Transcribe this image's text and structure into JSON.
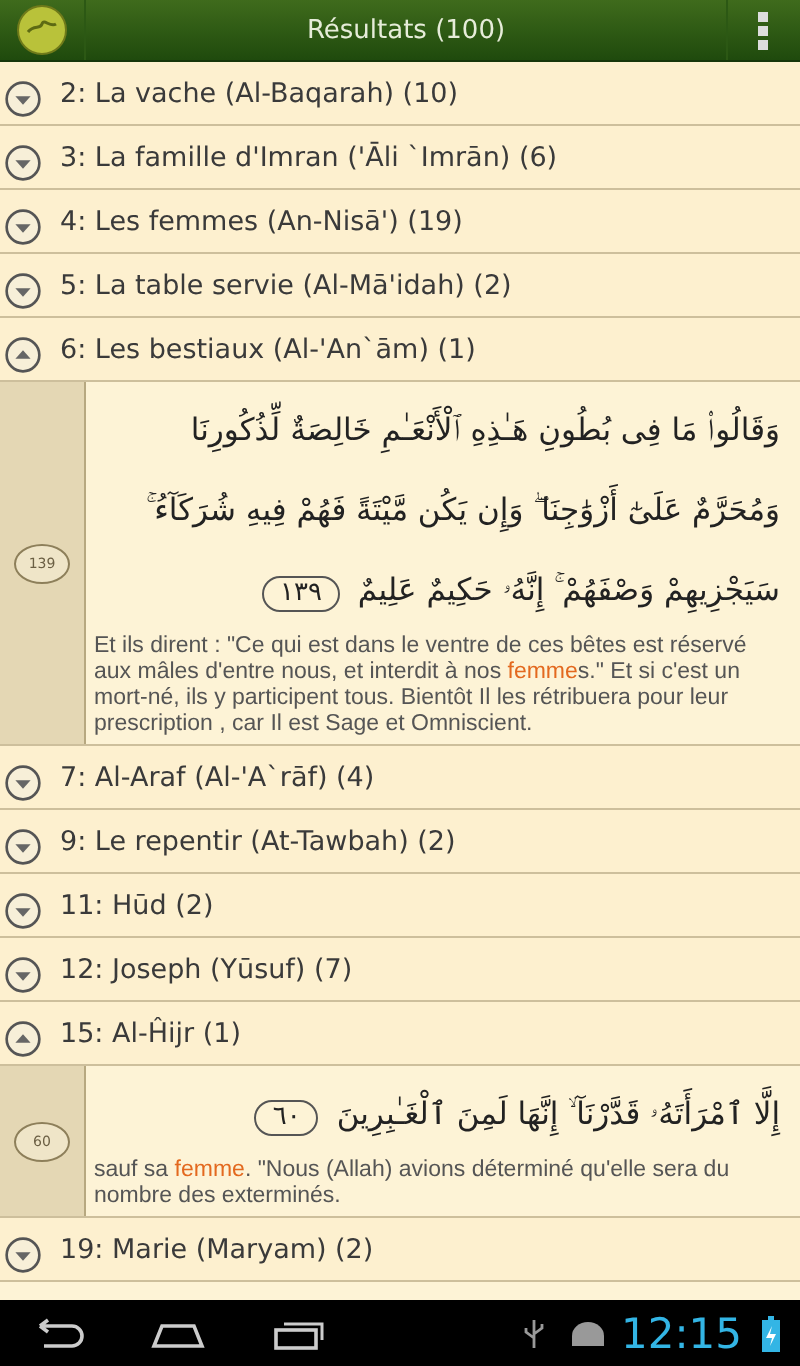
{
  "action_bar": {
    "title": "Résultats (100)"
  },
  "groups": [
    {
      "label": "2: La vache (Al-Baqarah) (10)",
      "expanded": false
    },
    {
      "label": "3: La famille d'Imran ('Āli `Imrān) (6)",
      "expanded": false
    },
    {
      "label": "4: Les femmes (An-Nisā') (19)",
      "expanded": false
    },
    {
      "label": "5: La table servie (Al-Mā'idah) (2)",
      "expanded": false
    },
    {
      "label": "6: Les bestiaux (Al-'An`ām) (1)",
      "expanded": true,
      "verses": [
        {
          "number": "139",
          "arabic": "وَقَالُوا۟ مَا فِى بُطُونِ هَـٰذِهِ ٱلْأَنْعَـٰمِ خَالِصَةٌ لِّذُكُورِنَا وَمُحَرَّمٌ عَلَىٰٓ أَزْوَٰجِنَا ۖ وَإِن يَكُن مَّيْتَةً فَهُمْ فِيهِ شُرَكَآءُ ۚ سَيَجْزِيهِمْ وَصْفَهُمْ ۚ إِنَّهُۥ حَكِيمٌ عَلِيمٌ",
          "verse_mark": "١٣٩",
          "translation": [
            {
              "text": "Et ils dirent : \"Ce qui est dans le ventre de ces bêtes est réservé aux mâles d'entre nous, et interdit à nos ",
              "highlight": false
            },
            {
              "text": "femme",
              "highlight": true
            },
            {
              "text": "s.\" Et si c'est un mort-né, ils y participent tous. Bientôt Il les rétribuera pour leur prescription , car Il est Sage et Omniscient.",
              "highlight": false
            }
          ]
        }
      ]
    },
    {
      "label": "7: Al-Araf (Al-'A`rāf) (4)",
      "expanded": false
    },
    {
      "label": "9: Le repentir (At-Tawbah) (2)",
      "expanded": false
    },
    {
      "label": "11: Hūd (2)",
      "expanded": false
    },
    {
      "label": "12: Joseph (Yūsuf) (7)",
      "expanded": false
    },
    {
      "label": "15: Al-Ĥijr (1)",
      "expanded": true,
      "verses": [
        {
          "number": "60",
          "arabic": "إِلَّا ٱمْرَأَتَهُۥ قَدَّرْنَآ ۙ إِنَّهَا لَمِنَ ٱلْغَـٰبِرِينَ",
          "verse_mark": "٦٠",
          "translation": [
            {
              "text": "sauf sa ",
              "highlight": false
            },
            {
              "text": "femme",
              "highlight": true
            },
            {
              "text": ". \"Nous (Allah) avions déterminé qu'elle sera du nombre des exterminés.",
              "highlight": false
            }
          ]
        }
      ]
    },
    {
      "label": "19: Marie (Maryam) (2)",
      "expanded": false
    }
  ],
  "status_bar": {
    "time": "12:15"
  }
}
